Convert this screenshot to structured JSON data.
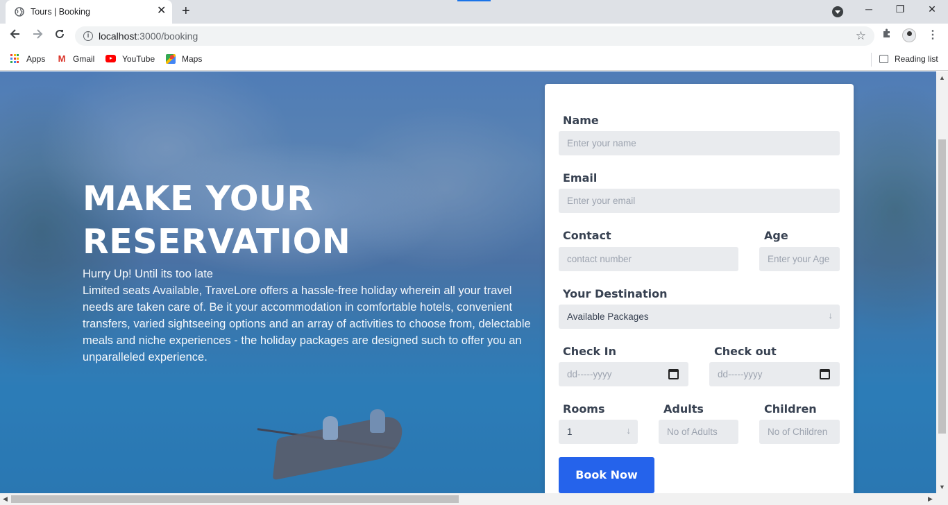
{
  "browser": {
    "tab_title": "Tours | Booking",
    "tab_close": "✕",
    "new_tab": "+",
    "url_host": "localhost",
    "url_rest": ":3000/booking",
    "bookmarks": [
      {
        "label": "Apps"
      },
      {
        "label": "Gmail"
      },
      {
        "label": "YouTube"
      },
      {
        "label": "Maps"
      }
    ],
    "reading_list": "Reading list"
  },
  "icons": {
    "back": "arrow-left-icon",
    "forward": "arrow-right-icon",
    "reload": "reload-icon",
    "info": "info-icon",
    "star": "star-icon",
    "extensions": "puzzle-icon",
    "menu": "kebab-menu-icon"
  },
  "hero": {
    "title": "MAKE YOUR RESERVATION",
    "tagline": "Hurry Up! Until its too late",
    "description": "Limited seats Available, TraveLore offers a hassle-free holiday wherein all your travel needs are taken care of. Be it your accommodation in comfortable hotels, convenient transfers, varied sightseeing options and an array of activities to choose from, delectable meals and niche experiences - the holiday packages are designed such to offer you an unparalleled experience."
  },
  "form": {
    "name_label": "Name",
    "name_placeholder": "Enter your name",
    "email_label": "Email",
    "email_placeholder": "Enter your email",
    "contact_label": "Contact",
    "contact_placeholder": "contact number",
    "age_label": "Age",
    "age_placeholder": "Enter your Age",
    "destination_label": "Your Destination",
    "destination_value": "Available Packages",
    "checkin_label": "Check In",
    "checkin_placeholder": "dd-----yyyy",
    "checkout_label": "Check out",
    "checkout_placeholder": "dd-----yyyy",
    "rooms_label": "Rooms",
    "rooms_value": "1",
    "adults_label": "Adults",
    "adults_placeholder": "No of Adults",
    "children_label": "Children",
    "children_placeholder": "No of Children",
    "submit_label": "Book Now"
  },
  "colors": {
    "accent": "#2563eb",
    "field_bg": "#e9ebee",
    "label": "#374151"
  }
}
